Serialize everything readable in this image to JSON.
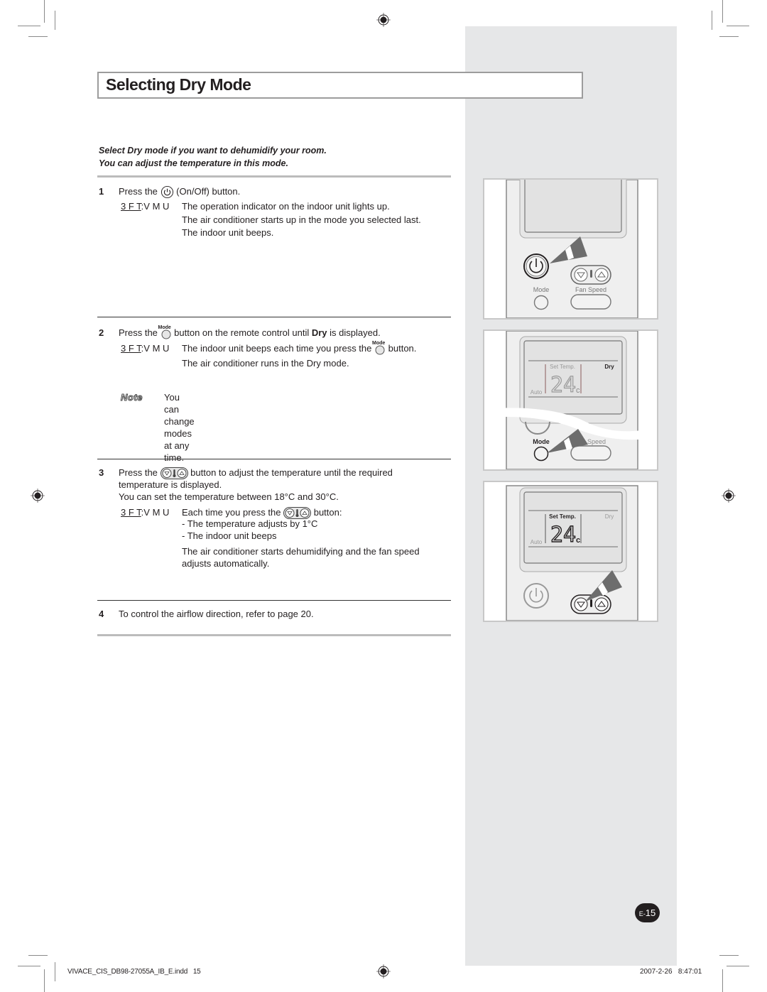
{
  "title": "Selecting Dry Mode",
  "intro": {
    "line1": "Select Dry mode if you want to dehumidify your room.",
    "line2": "You can adjust the temperature in this mode."
  },
  "result_label": {
    "underlined": "3 F T",
    "rest": ":V M U"
  },
  "steps": [
    {
      "number": "1",
      "line_before_icon": "Press the",
      "icon": "power-icon",
      "line_after_icon": "(On/Off) button.",
      "results": [
        "The operation indicator on the indoor unit lights up.",
        "The air conditioner starts up in the mode you selected last.",
        "The indoor unit beeps."
      ]
    },
    {
      "number": "2",
      "line_before_icon": "Press the",
      "icon": "mode-button-icon",
      "icon_caption": "Mode",
      "line_after_icon_a": "button on the remote control until",
      "line_bold": "Dry",
      "line_after_icon_b": "is displayed.",
      "result_before_icon": "The indoor unit beeps each time you press the",
      "result_after_icon": "button.",
      "results_extra": [
        "The air conditioner runs in the Dry mode."
      ],
      "note_label": "Note",
      "note_text": "You can change modes at any time."
    },
    {
      "number": "3",
      "line_before_icon": "Press the",
      "icon": "temperature-button-icon",
      "line_after_icon": "button to adjust the temperature until the required",
      "line2": "temperature is displayed.",
      "line3": "You can set the temperature between 18°C and 30°C.",
      "result_before_icon": "Each time you press the",
      "result_after_icon": "button:",
      "result_bullets": [
        "- The temperature adjusts by 1°C",
        "- The indoor unit beeps"
      ],
      "result_para": [
        "The air conditioner starts dehumidifying and the fan speed",
        "adjusts automatically."
      ]
    },
    {
      "number": "4",
      "line": "To control the airflow direction, refer to page 20."
    }
  ],
  "illustrations": {
    "remote1": {
      "mode_label": "Mode",
      "fan_label": "Fan Speed"
    },
    "remote2": {
      "set_temp": "Set Temp.",
      "mode_text": "Dry",
      "auto_text": "Auto",
      "temp": "24",
      "unit": "c",
      "mode_label": "Mode",
      "fan_label": "Speed"
    },
    "remote3": {
      "set_temp": "Set Temp.",
      "mode_text": "Dry",
      "auto_text": "Auto",
      "temp": "24",
      "unit": "c"
    }
  },
  "page_number": {
    "prefix": "E-",
    "number": "15"
  },
  "footer": {
    "file": "VIVACE_CIS_DB98-27055A_IB_E.indd   15",
    "timestamp": "2007-2-26   8:47:01"
  }
}
